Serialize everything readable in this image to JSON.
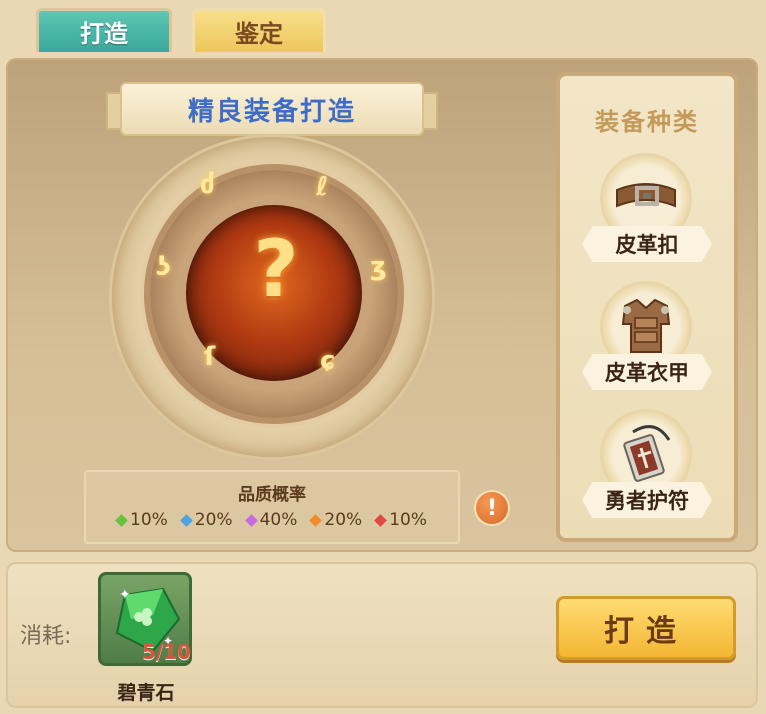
{
  "tabs": [
    {
      "label": "打造",
      "active": true
    },
    {
      "label": "鉴定",
      "active": false
    }
  ],
  "forge": {
    "title": "精良装备打造",
    "result_placeholder": "?"
  },
  "quality": {
    "title": "品质概率",
    "rates": [
      {
        "value": "10%",
        "color": "#6bbf3e"
      },
      {
        "value": "20%",
        "color": "#4fa3e3"
      },
      {
        "value": "40%",
        "color": "#c86be0"
      },
      {
        "value": "20%",
        "color": "#f08c2b"
      },
      {
        "value": "10%",
        "color": "#e04848"
      }
    ]
  },
  "equipment_types": {
    "title": "装备种类",
    "items": [
      {
        "label": "皮革扣",
        "icon": "belt-icon"
      },
      {
        "label": "皮革衣甲",
        "icon": "leather-armor-icon"
      },
      {
        "label": "勇者护符",
        "icon": "amulet-icon"
      }
    ]
  },
  "cost": {
    "label": "消耗:",
    "material": {
      "name": "碧青石",
      "count": "5/10",
      "icon": "emerald-gem-icon"
    }
  },
  "forge_button": {
    "label": "打造"
  },
  "info_button": {
    "symbol": "!"
  }
}
